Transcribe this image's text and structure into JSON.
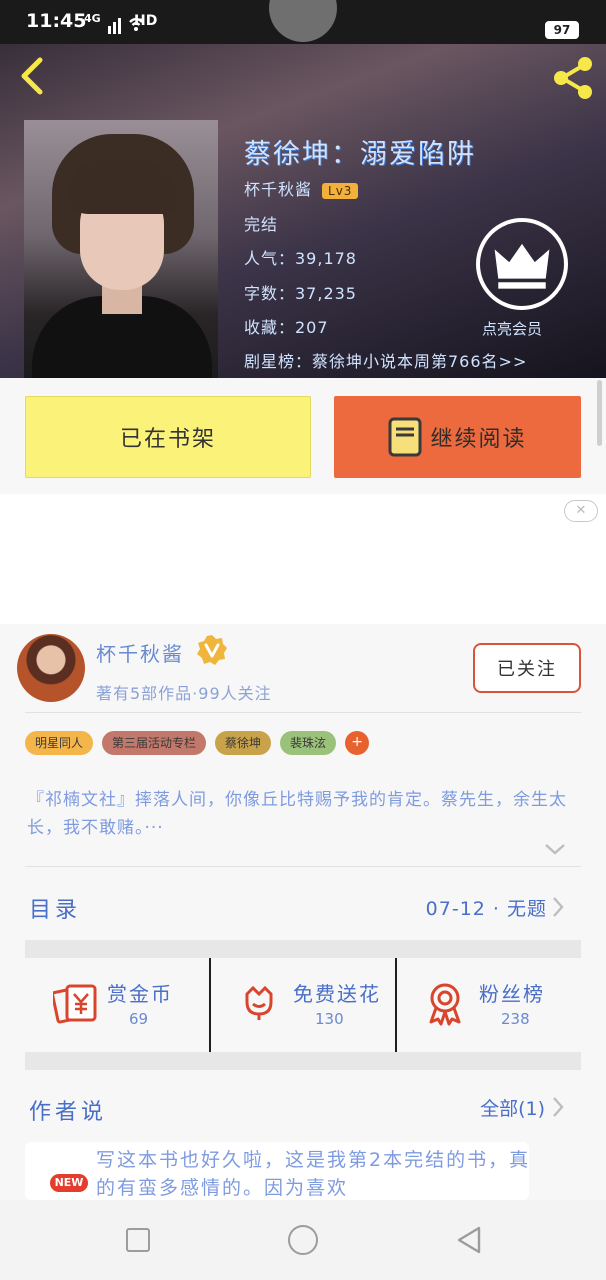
{
  "status_bar": {
    "time": "11:45",
    "network": "4G",
    "hd": "HD",
    "battery": "97"
  },
  "book": {
    "title": "蔡徐坤：溺爱陷阱",
    "author": "杯千秋酱",
    "level": "Lv3",
    "status": "完结",
    "popularity": "人气：39,178",
    "word_count": "字数：37,235",
    "favorites": "收藏：207",
    "rank": "剧星榜：蔡徐坤小说本周第766名>>"
  },
  "vip": {
    "label": "点亮会员",
    "icon": "crown-icon"
  },
  "actions": {
    "shelf": "已在书架",
    "read": "继续阅读"
  },
  "ad": {
    "close": "✕"
  },
  "author": {
    "name": "杯千秋酱",
    "summary": "著有5部作品·99人关注",
    "follow": "已关注"
  },
  "tags": [
    {
      "label": "明星同人",
      "color": "#f4b54a"
    },
    {
      "label": "第三届活动专栏",
      "color": "#c2786a"
    },
    {
      "label": "蔡徐坤",
      "color": "#c9a34a"
    },
    {
      "label": "裴珠泫",
      "color": "#9bc27a"
    }
  ],
  "tag_more": "+",
  "description": "『祁楠文社』摔落人间，你像丘比特赐予我的肯定。蔡先生，余生太长，我不敢赌。···",
  "catalog": {
    "title": "目录",
    "latest": "07-12 · 无题"
  },
  "stats": [
    {
      "label": "赏金币",
      "value": "69",
      "icon": "coin-red-packet-icon"
    },
    {
      "label": "免费送花",
      "value": "130",
      "icon": "flower-icon"
    },
    {
      "label": "粉丝榜",
      "value": "238",
      "icon": "medal-icon"
    }
  ],
  "author_says": {
    "title": "作者说",
    "all": "全部(1)",
    "badge": "NEW",
    "text": "写这本书也好久啦，这是我第2本完结的书，真的有蛮多感情的。因为喜欢"
  },
  "colors": {
    "accent": "#ec6a3d",
    "shelf": "#fbf27a",
    "text_blue": "#4a6fc8"
  }
}
